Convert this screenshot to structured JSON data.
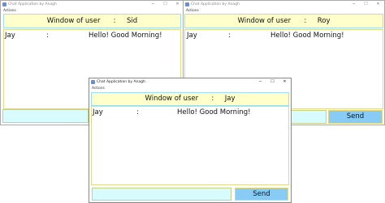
{
  "windows": {
    "sid": {
      "title": "Chat Application by Anagh",
      "menu": "Actions",
      "header": {
        "prefix": "Window of user",
        "separator": ":",
        "user": "Sid"
      },
      "message": {
        "sender": "Jay",
        "separator": ":",
        "text": "Hello! Good Morning!"
      },
      "send_label": "Send"
    },
    "roy": {
      "title": "Chat Application by Anagh",
      "menu": "Actions",
      "header": {
        "prefix": "Window of user",
        "separator": ":",
        "user": "Roy"
      },
      "message": {
        "sender": "Jay",
        "separator": ":",
        "text": "Hello! Good Morning!"
      },
      "send_label": "Send"
    },
    "jay": {
      "title": "Chat Application by Anagh",
      "menu": "Actions",
      "header": {
        "prefix": "Window of user",
        "separator": ":",
        "user": "Jay"
      },
      "message": {
        "sender": "Jay",
        "separator": ":",
        "text": "Hello! Good Morning!"
      },
      "send_label": "Send"
    }
  },
  "controls": {
    "minimize": "─",
    "maximize": "☐",
    "close": "✕"
  },
  "colors": {
    "header_bg": "#ffffcc",
    "input_bg": "#d8fbfd",
    "send_bg": "#88ccf5",
    "chat_border": "#e4d88a"
  }
}
